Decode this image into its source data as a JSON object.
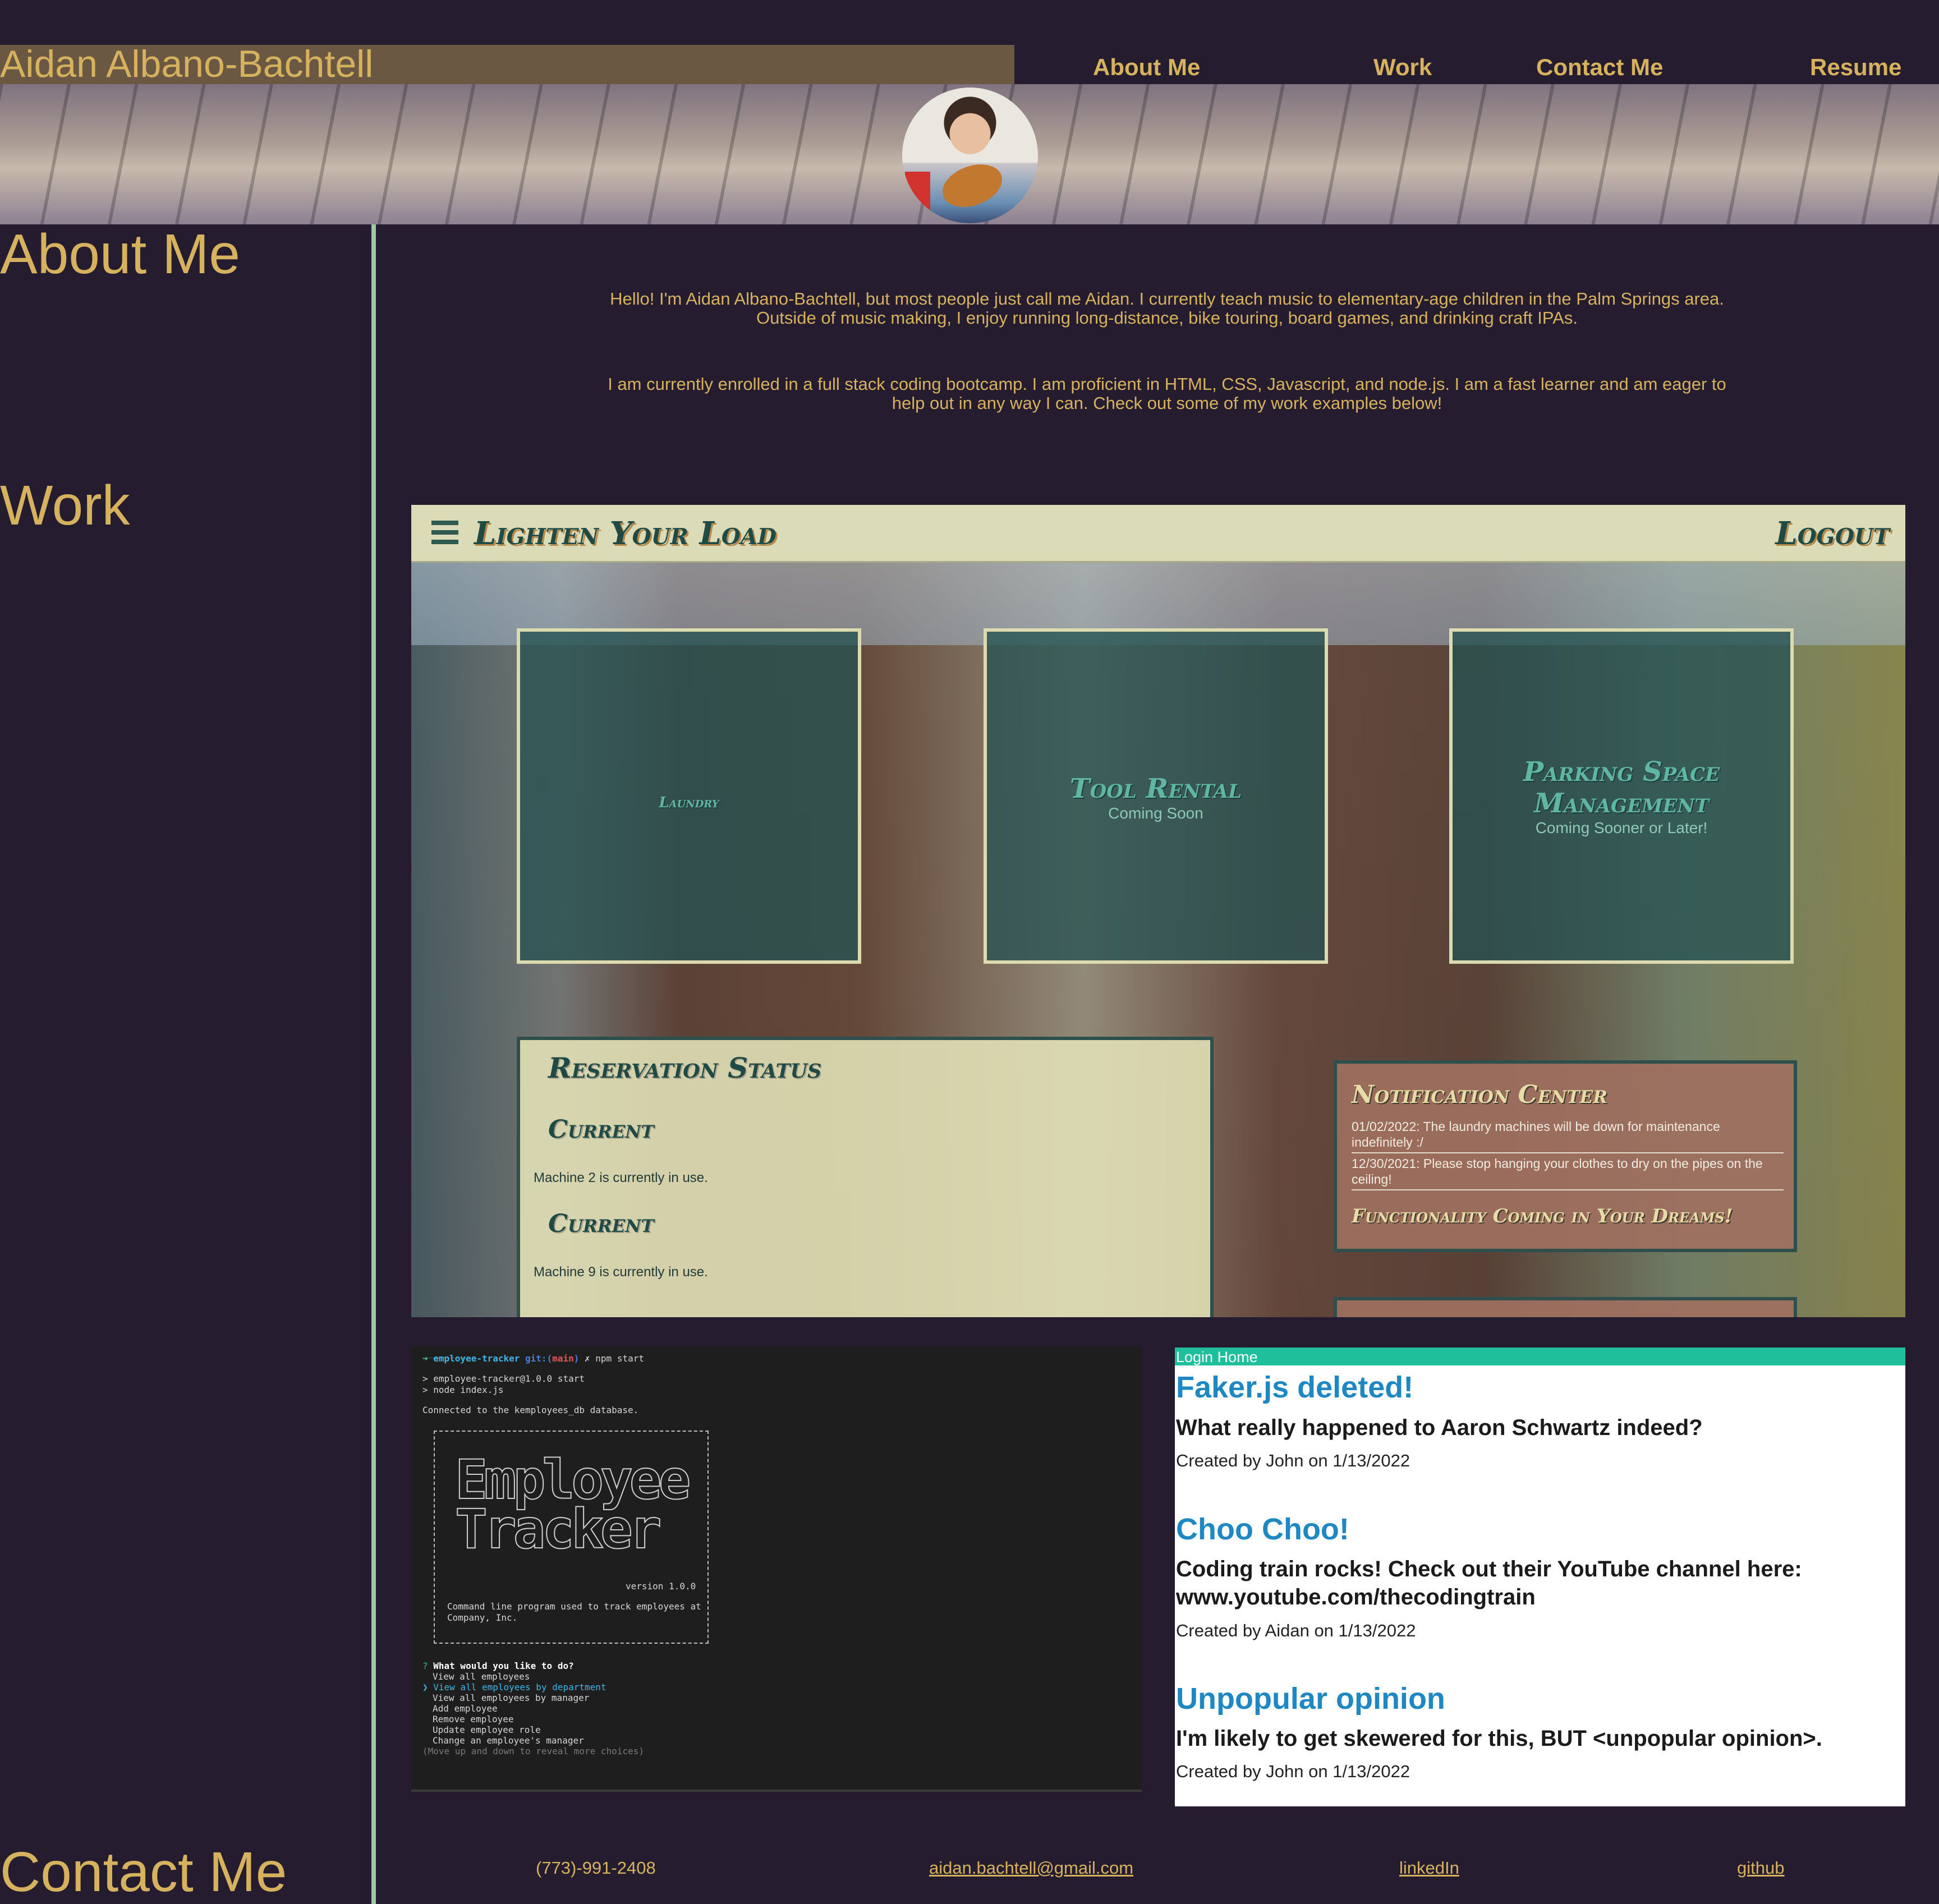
{
  "header": {
    "name": "Aidan Albano-Bachtell",
    "nav": [
      "About Me",
      "Work",
      "Contact Me",
      "Resume"
    ]
  },
  "about": {
    "heading": "About Me",
    "paragraph1": "Hello! I'm Aidan Albano-Bachtell, but most people just call me Aidan. I currently teach music to elementary-age children in the Palm Springs area. Outside of music making, I enjoy running long-distance, bike touring, board games, and drinking craft IPAs.",
    "paragraph2": "I am currently enrolled in a full stack coding bootcamp. I am proficient in HTML, CSS, Javascript, and node.js. I am a fast learner and am eager to help out in any way I can. Check out some of my work examples below!"
  },
  "work": {
    "heading": "Work",
    "project1": {
      "brand": "Lighten Your Load",
      "logout": "Logout",
      "cards": [
        {
          "title": "Laundry",
          "subtitle": ""
        },
        {
          "title": "Tool Rental",
          "subtitle": "Coming Soon"
        },
        {
          "title": "Parking Space Management",
          "subtitle": "Coming Sooner or Later!"
        }
      ],
      "reservation": {
        "heading": "Reservation Status",
        "items": [
          {
            "label": "Current",
            "text": "Machine 2 is currently in use."
          },
          {
            "label": "Current",
            "text": "Machine 9 is currently in use."
          }
        ]
      },
      "notifications": {
        "heading": "Notification Center",
        "items": [
          "01/02/2022: The laundry machines will be down for maintenance indefinitely :/",
          "12/30/2021: Please stop hanging your clothes to dry on the pipes on the ceiling!"
        ],
        "footer": "Functionality Coming in Your Dreams!"
      }
    },
    "project2": {
      "prompt_dir": "employee-tracker",
      "prompt_git": "git:(",
      "prompt_branch": "main",
      "prompt_git_end": ")",
      "prompt_cmd": "✗ npm start",
      "line1": "> employee-tracker@1.0.0 start",
      "line2": "> node index.js",
      "line3": "Connected to the kemployees_db database.",
      "ascii1": "Employee",
      "ascii2": "Tracker",
      "version": "version 1.0.0",
      "desc1": "Command line program used to track employees at",
      "desc2": "Company, Inc.",
      "question": "What would you like to do?",
      "options": [
        "View all employees",
        "View all employees by department",
        "View all employees by manager",
        "Add employee",
        "Remove employee",
        "Update employee role",
        "Change an employee's manager"
      ],
      "hint": "(Move up and down to reveal more choices)"
    },
    "project3": {
      "nav": "Login Home",
      "posts": [
        {
          "title": "Faker.js deleted!",
          "body": "What really happened to Aaron Schwartz indeed?",
          "meta": "Created by John on 1/13/2022"
        },
        {
          "title": "Choo Choo!",
          "body": "Coding train rocks! Check out their YouTube channel here: www.youtube.com/thecodingtrain",
          "meta": "Created by Aidan on 1/13/2022"
        },
        {
          "title": "Unpopular opinion",
          "body": "I'm likely to get skewered for this, BUT <unpopular opinion>.",
          "meta": "Created by John on 1/13/2022"
        }
      ]
    }
  },
  "contact": {
    "heading": "Contact Me",
    "phone": "(773)-991-2408",
    "email": "aidan.bachtell@gmail.com",
    "linkedin": "linkedIn",
    "github": "github"
  },
  "colors": {
    "background": "#251d2f",
    "accent": "#d6b25e",
    "divider": "#9fc6a0",
    "name_bar": "#6b5843"
  }
}
